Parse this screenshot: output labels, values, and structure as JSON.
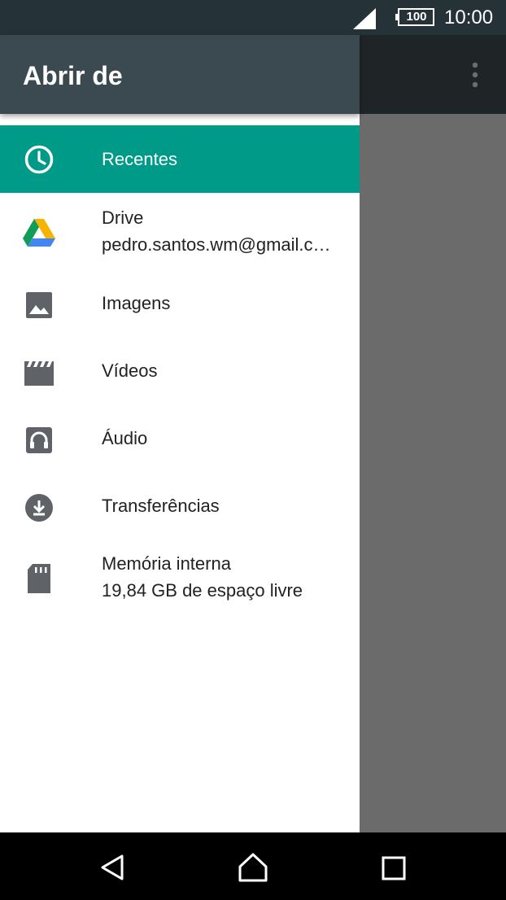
{
  "status_bar": {
    "battery": "100",
    "time": "10:00"
  },
  "drawer": {
    "title": "Abrir de",
    "items": [
      {
        "label": "Recentes",
        "icon": "clock-icon",
        "active": true
      },
      {
        "label": "Drive",
        "sublabel": "pedro.santos.wm@gmail.com",
        "icon": "google-drive-icon"
      },
      {
        "label": "Imagens",
        "icon": "image-icon"
      },
      {
        "label": "Vídeos",
        "icon": "video-clapper-icon"
      },
      {
        "label": "Áudio",
        "icon": "headphones-icon"
      },
      {
        "label": "Transferências",
        "icon": "download-icon"
      },
      {
        "label": "Memória interna",
        "sublabel": "19,84 GB de espaço livre",
        "icon": "sd-card-icon"
      }
    ]
  },
  "colors": {
    "accent": "#009a88",
    "header": "#3a4a50",
    "status_bar": "#253238"
  }
}
